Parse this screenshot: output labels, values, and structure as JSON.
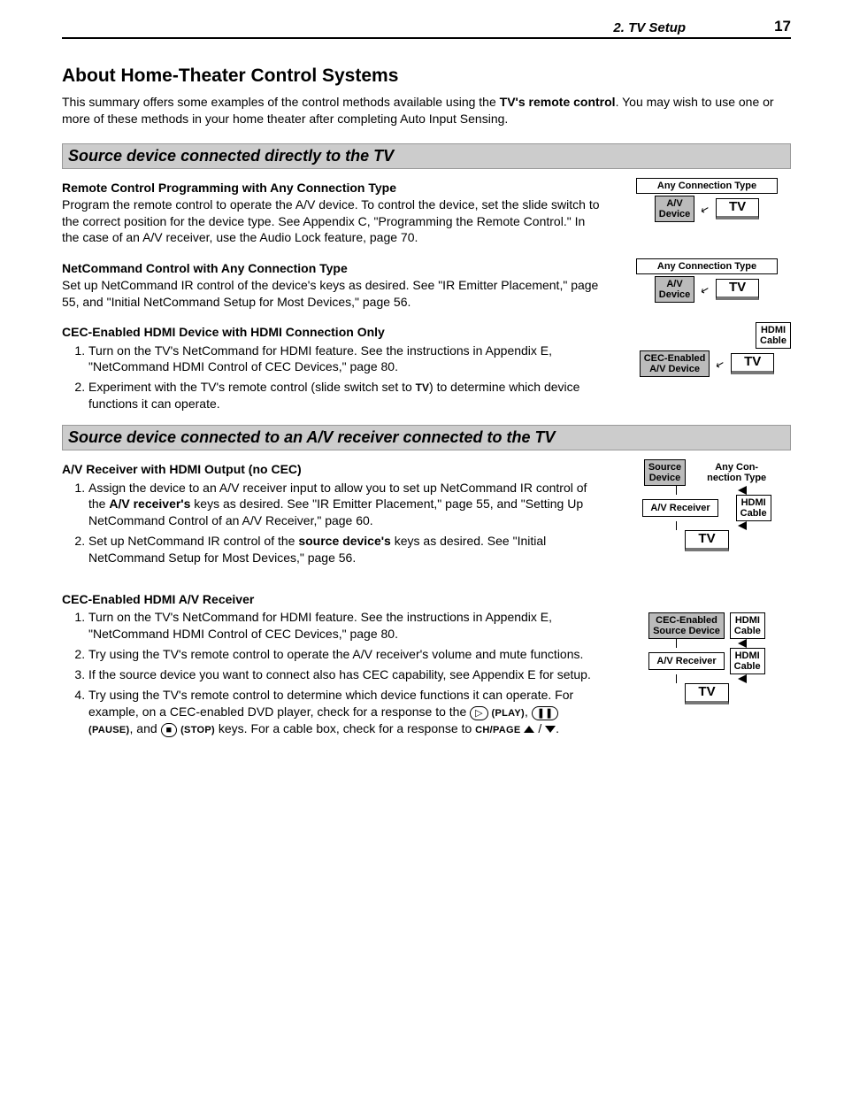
{
  "header": {
    "chapter": "2.  TV Setup",
    "page": "17"
  },
  "title": "About Home-Theater Control Systems",
  "intro_a": "This summary offers some examples of the control methods available using the ",
  "intro_b": "TV's remote control",
  "intro_c": ".  You may wish to use one or more of these methods in your home theater after completing Auto Input Sensing.",
  "section1": {
    "heading": "Source device connected directly to the TV",
    "b1_head": "Remote Control Programming with Any Connection Type",
    "b1_text": "Program the remote control to operate the A/V device.  To control the device, set the slide switch to the correct position for the device type.  See Appendix  C, \"Programming the Remote Control.\"  In the case of an A/V receiver, use the Audio Lock feature, page 70.",
    "b2_head": "NetCommand Control with Any Connection Type",
    "b2_text": "Set up NetCommand IR control of the device's keys as desired.  See \"IR Emitter Placement,\" page 55, and \"Initial NetCommand Setup for Most Devices,\" page 56.",
    "b3_head": "CEC-Enabled HDMI Device with HDMI Connection Only",
    "b3_li1": "Turn on the TV's NetCommand for HDMI feature.  See the instructions in Appendix E, \"NetCommand HDMI Control of CEC Devices,\" page 80.",
    "b3_li2a": "Experiment with the TV's remote control (slide switch set to ",
    "b3_li2_tv": "TV",
    "b3_li2b": ") to determine which device functions it can operate."
  },
  "section2": {
    "heading": "Source device connected to an A/V receiver connected to the TV",
    "b1_head": "A/V Receiver with HDMI Output (no CEC)",
    "b1_li1a": "Assign the device to an A/V receiver input to allow you to set up NetCommand IR control of the ",
    "b1_li1b": "A/V receiver's",
    "b1_li1c": " keys as desired.  See \"IR Emitter Placement,\" page 55, and \"Setting Up NetCommand Control of an A/V Receiver,\" page 60.",
    "b1_li2a": "Set up NetCommand IR control of the ",
    "b1_li2b": "source device's",
    "b1_li2c": " keys as desired.  See \"Initial NetCommand Setup for Most Devices,\" page 56.",
    "b2_head": "CEC-Enabled HDMI A/V Receiver",
    "b2_li1": "Turn on the TV's NetCommand for HDMI feature.  See the instructions in Appendix E, \"NetCommand HDMI Control of CEC Devices,\" page 80.",
    "b2_li2": "Try using the TV's remote control to operate the A/V receiver's volume and mute functions.",
    "b2_li3": "If the source device you want to connect also has CEC capability, see Appendix E for setup.",
    "b2_li4a": "Try using the TV's remote control to determine which device functions it can operate.  For example, on a CEC-enabled DVD player, check for a response to the ",
    "b2_li4_play": "(PLAY)",
    "b2_li4_pause": "(PAUSE)",
    "b2_li4_and": ", and ",
    "b2_li4_stop": "(STOP)",
    "b2_li4b": " keys.  For a cable box, check for a response to ",
    "b2_li4_ch": "CH/PAGE",
    "b2_li4c": "."
  },
  "diagrams": {
    "any_conn": "Any Connection Type",
    "av_device": "A/V\nDevice",
    "tv": "TV",
    "hdmi_cable": "HDMI\nCable",
    "cec_av_device": "CEC-Enabled\nA/V Device",
    "source_device": "Source\nDevice",
    "any_conn2": "Any Con-\nnection Type",
    "av_receiver": "A/V Receiver",
    "cec_source": "CEC-Enabled\nSource Device"
  }
}
